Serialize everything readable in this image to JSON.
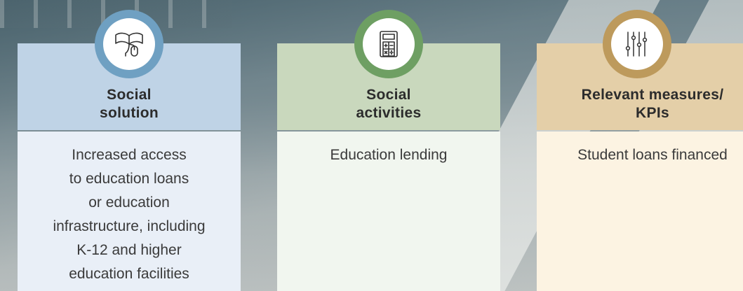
{
  "colors": {
    "solution_accent": "#6fa0c2",
    "solution_head": "#bfd3e6",
    "solution_body": "#e9eff7",
    "activities_accent": "#6e9f63",
    "activities_head": "#c9d8bd",
    "activities_body": "#f1f6ef",
    "measures_accent": "#bd9a5c",
    "measures_head": "#e4cfa8",
    "measures_body": "#fcf3e2"
  },
  "columns": [
    {
      "icon": "book-mouse-icon",
      "title_lines": [
        "Social",
        "solution"
      ],
      "body_lines": [
        "Increased access",
        "to education loans",
        "or education",
        "infrastructure, including",
        "K-12 and higher",
        "education facilities"
      ]
    },
    {
      "icon": "calculator-icon",
      "title_lines": [
        "Social",
        "activities"
      ],
      "body_lines": [
        "Education lending"
      ]
    },
    {
      "icon": "sliders-icon",
      "title_lines": [
        "Relevant measures/",
        "KPIs"
      ],
      "body_lines": [
        "Student loans financed"
      ]
    }
  ]
}
